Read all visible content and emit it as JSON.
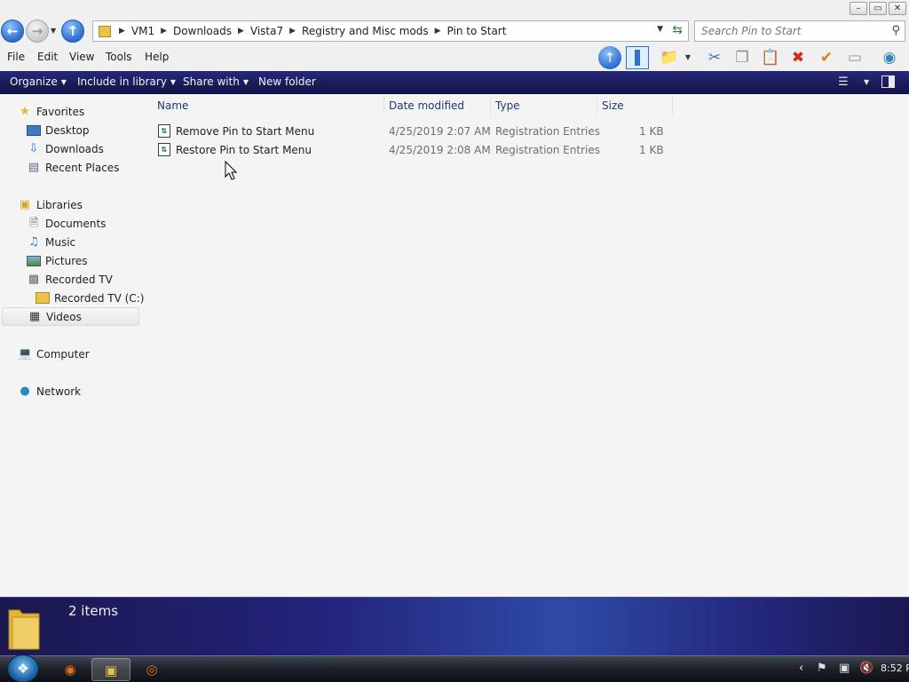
{
  "window": {
    "minimize_glyph": "–",
    "maximize_glyph": "▭",
    "close_glyph": "✕"
  },
  "address": {
    "breadcrumbs": [
      "VM1",
      "Downloads",
      "Vista7",
      "Registry and Misc mods",
      "Pin to Start"
    ],
    "search_placeholder": "Search Pin to Start"
  },
  "menu": {
    "items": [
      "File",
      "Edit",
      "View",
      "Tools",
      "Help"
    ]
  },
  "commandbar": {
    "organize": "Organize",
    "include_in_library": "Include in library",
    "share_with": "Share with",
    "new_folder": "New folder"
  },
  "navpane": {
    "favorites": {
      "label": "Favorites",
      "items": [
        "Desktop",
        "Downloads",
        "Recent Places"
      ]
    },
    "libraries": {
      "label": "Libraries",
      "items": [
        "Documents",
        "Music",
        "Pictures",
        "Recorded TV",
        "Recorded TV (C:)",
        "Videos"
      ]
    },
    "computer": "Computer",
    "network": "Network",
    "selected": "Videos"
  },
  "filelist": {
    "columns": [
      "Name",
      "Date modified",
      "Type",
      "Size"
    ],
    "rows": [
      {
        "name": "Remove Pin to Start Menu",
        "date": "4/25/2019 2:07 AM",
        "type": "Registration Entries",
        "size": "1 KB"
      },
      {
        "name": "Restore Pin to Start Menu",
        "date": "4/25/2019 2:08 AM",
        "type": "Registration Entries",
        "size": "1 KB"
      }
    ]
  },
  "details": {
    "item_count": "2 items"
  },
  "taskbar": {
    "clock": "8:52 P"
  },
  "colors": {
    "command_bar": "#1b1c5a",
    "details_pane": "#23237a",
    "link_header": "#1e3a6e"
  }
}
